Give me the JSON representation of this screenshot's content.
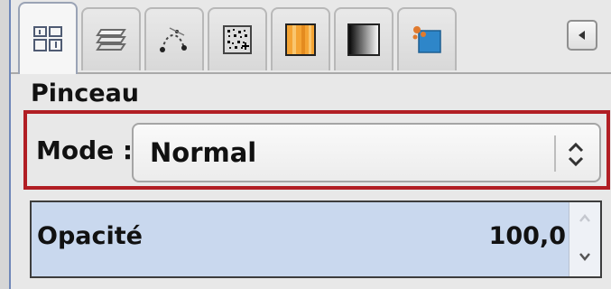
{
  "tabs": [
    {
      "id": "tool-options",
      "icon": "tool-options-icon",
      "active": true
    },
    {
      "id": "layers",
      "icon": "layers-icon",
      "active": false
    },
    {
      "id": "paths",
      "icon": "paths-icon",
      "active": false
    },
    {
      "id": "brushes",
      "icon": "brush-icon",
      "active": false
    },
    {
      "id": "patterns",
      "icon": "pattern-icon",
      "active": false
    },
    {
      "id": "gradients",
      "icon": "gradient-icon",
      "active": false
    },
    {
      "id": "channels",
      "icon": "channels-icon",
      "active": false
    }
  ],
  "panel": {
    "title": "Pinceau",
    "mode_label": "Mode :",
    "mode_value": "Normal",
    "opacity_label": "Opacité",
    "opacity_value": "100,0",
    "opacity_fraction": 1.0
  },
  "colors": {
    "highlight_border": "#b11e24",
    "opacity_fill": "#c9d8ee"
  }
}
